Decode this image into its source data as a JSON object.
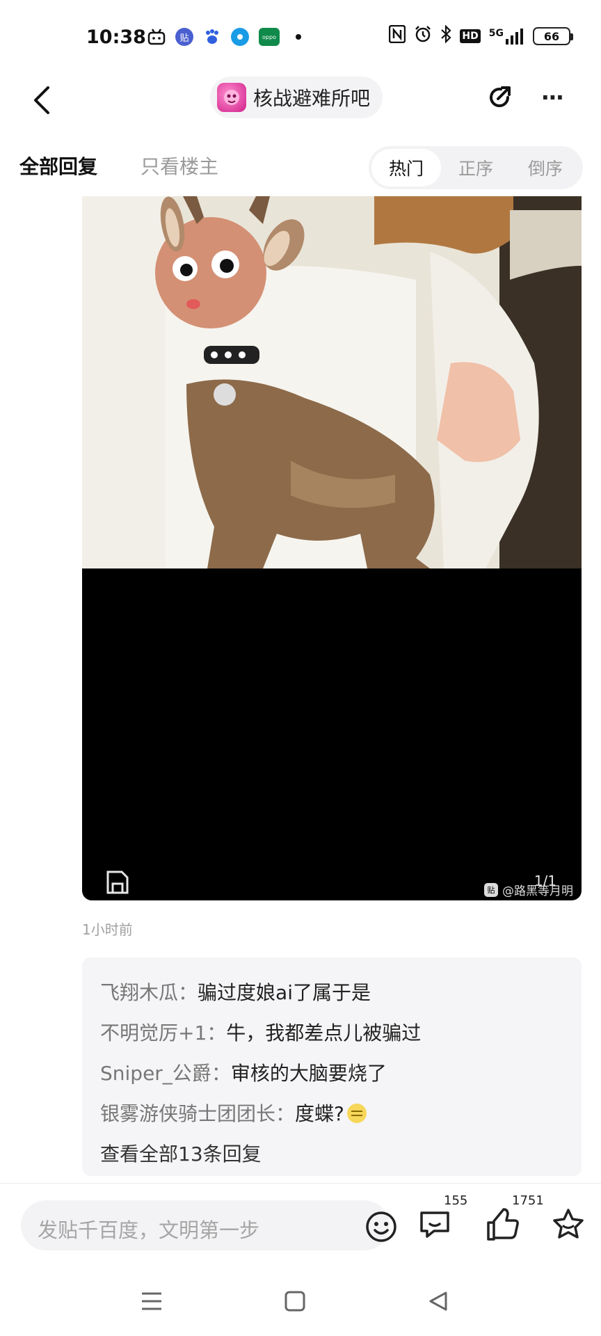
{
  "status_bar": {
    "time": "10:38",
    "left_icons": [
      "bilibili-icon",
      "tieba-icon",
      "baidu-icon",
      "browser-icon",
      "oppo-icon",
      "dot-icon"
    ],
    "right_icons": [
      "nfc-icon",
      "alarm-icon",
      "bluetooth-icon",
      "hd-icon",
      "signal-5g-icon"
    ],
    "hd_label": "HD",
    "network_label": "5G",
    "battery": "66"
  },
  "nav": {
    "forum_name": "核战避难所吧",
    "more_label": "⋯"
  },
  "filter": {
    "tab_all": "全部回复",
    "tab_op_only": "只看楼主",
    "sort_options": [
      "热门",
      "正序",
      "倒序"
    ],
    "active_sort": "热门"
  },
  "post": {
    "image_counter": "1/1",
    "watermark": "@路黑等月明",
    "watermark_badge": "贴",
    "time": "1小时前"
  },
  "replies": {
    "items": [
      {
        "author": "飞翔木瓜",
        "sep": "：",
        "text": "骗过度娘ai了属于是"
      },
      {
        "author": "不明觉厉+1",
        "sep": "：",
        "text": "牛，我都差点儿被骗过"
      },
      {
        "author": "Sniper_公爵",
        "sep": "：",
        "text": "审核的大脑要烧了"
      },
      {
        "author": "银雾游侠骑士团团长",
        "sep": "：",
        "text": "度蝶?"
      }
    ],
    "view_all": "查看全部13条回复"
  },
  "bottom_bar": {
    "compose_placeholder": "发贴千百度，文明第一步",
    "comment_count": "155",
    "like_count": "1751"
  },
  "colors": {
    "accent_pink": "#d0208a",
    "secondary_text": "#9a9a9a",
    "reply_bg": "#f5f5f7"
  }
}
